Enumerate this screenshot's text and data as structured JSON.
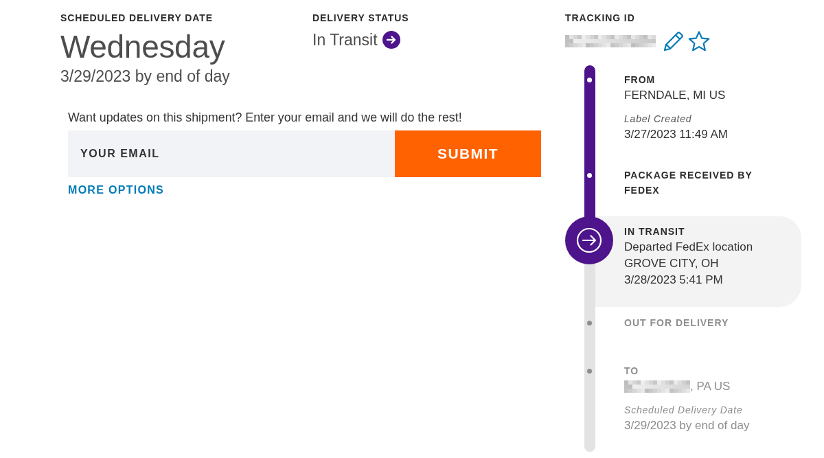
{
  "summary": {
    "scheduled": {
      "label": "SCHEDULED DELIVERY DATE",
      "day": "Wednesday",
      "date": "3/29/2023 by end of day"
    },
    "status": {
      "label": "DELIVERY STATUS",
      "value": "In Transit"
    }
  },
  "notify": {
    "prompt": "Want updates on this shipment? Enter your email and we will do the rest!",
    "email": {
      "placeholder": "YOUR EMAIL"
    },
    "submit": "SUBMIT",
    "more_link": "MORE OPTIONS"
  },
  "tracking": {
    "label": "TRACKING ID",
    "redacted": true
  },
  "timeline": [
    {
      "kind": "completed",
      "title": "FROM",
      "lines": [
        {
          "text": "FERNDALE, MI US",
          "redacted": false
        }
      ],
      "note_label": "Label Created",
      "note_value": "3/27/2023 11:49 AM"
    },
    {
      "kind": "completed",
      "title": "PACKAGE RECEIVED BY FEDEX"
    },
    {
      "kind": "current",
      "title": "IN TRANSIT",
      "lines": [
        {
          "text": "Departed FedEx location",
          "redacted": false
        },
        {
          "text": "GROVE CITY, OH",
          "redacted": false
        },
        {
          "text": "3/28/2023 5:41 PM",
          "redacted": false
        }
      ]
    },
    {
      "kind": "upcoming",
      "title": "OUT FOR DELIVERY"
    },
    {
      "kind": "upcoming",
      "title": "TO",
      "lines": [
        {
          "text": ", PA US",
          "redacted": true
        }
      ],
      "note_label": "Scheduled Delivery Date",
      "note_value": "3/29/2023 by end of day"
    }
  ]
}
